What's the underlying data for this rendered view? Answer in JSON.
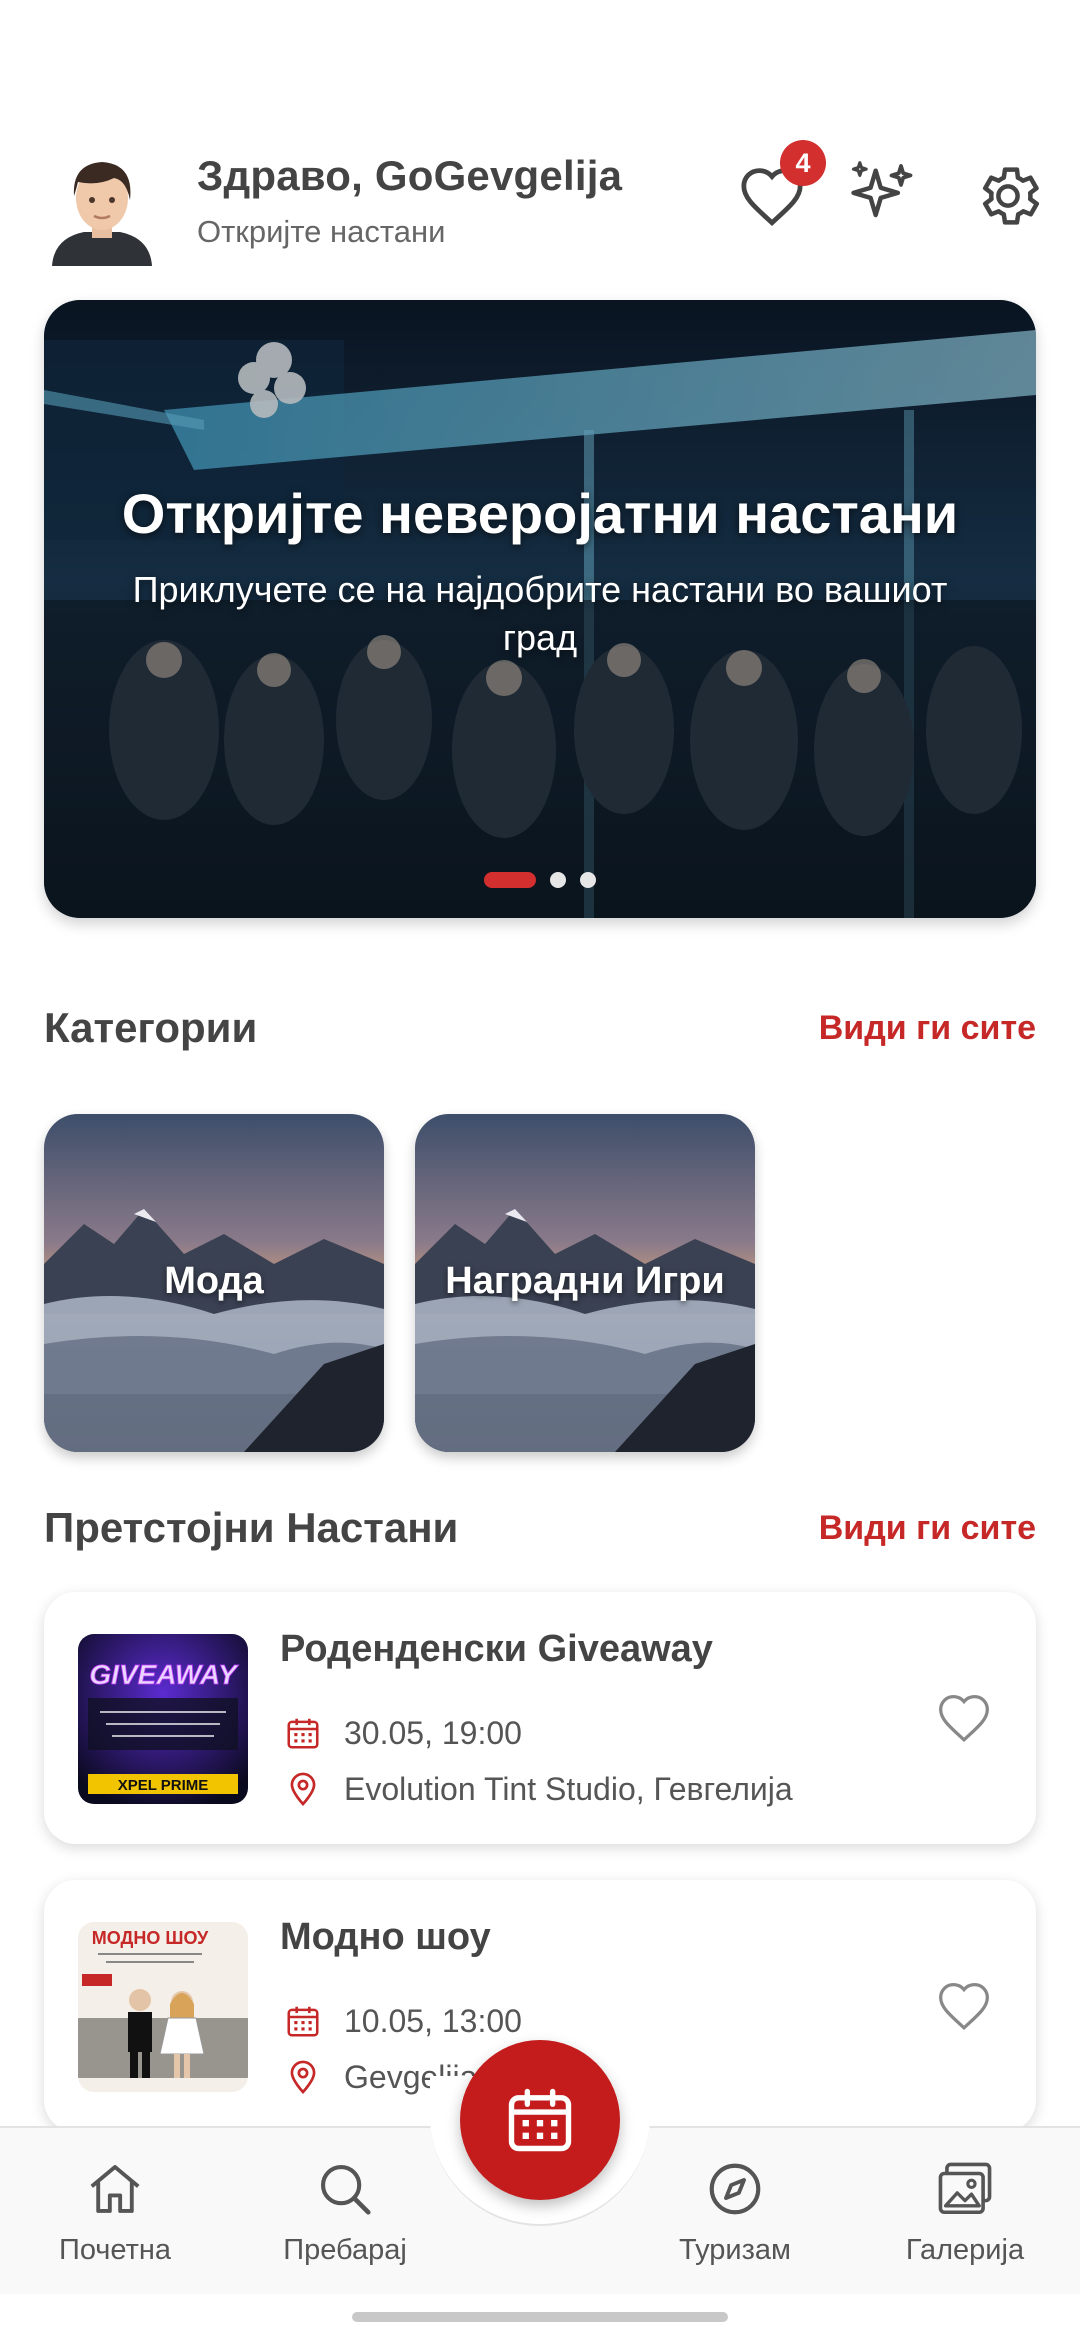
{
  "header": {
    "greeting": "Здраво, GoGevgelija",
    "subtitle": "Откријте настани",
    "favorites_count": "4"
  },
  "hero": {
    "title": "Откријте неверојатни настани",
    "subtitle": "Приклучете се на најдобрите настани во вашиот град",
    "slide_count": 3,
    "active_slide": 1
  },
  "categories": {
    "title": "Категории",
    "see_all": "Види ги сите",
    "items": [
      {
        "label": "Мода"
      },
      {
        "label": "Наградни Игри"
      }
    ]
  },
  "events": {
    "title": "Претстојни Настани",
    "see_all": "Види ги сите",
    "items": [
      {
        "title": "Роденденски Giveaway",
        "date": "30.05, 19:00",
        "location": "Evolution Tint Studio, Гевгелија",
        "thumb_text": "GIVEAWAY",
        "thumb_sub": "XPEL PRIME"
      },
      {
        "title": "Модно шоу",
        "date": "10.05, 13:00",
        "location": "Gevgelija",
        "thumb_text": "МОДНО ШОУ"
      }
    ]
  },
  "nav": {
    "items": [
      {
        "label": "Почетна",
        "icon": "home-icon"
      },
      {
        "label": "Пребарај",
        "icon": "search-icon"
      },
      {
        "label": "Туризам",
        "icon": "compass-icon"
      },
      {
        "label": "Галерија",
        "icon": "gallery-icon"
      }
    ],
    "fab_icon": "calendar-icon"
  },
  "colors": {
    "accent": "#c62828",
    "badge": "#d32f2f",
    "fab": "#c41c1c"
  }
}
